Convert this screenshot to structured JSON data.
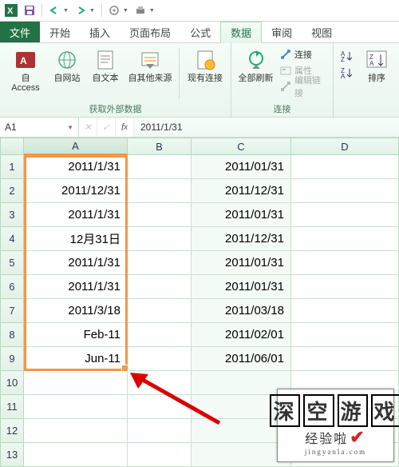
{
  "qat_icons": [
    "excel",
    "save",
    "undo",
    "redo",
    "touch",
    "print"
  ],
  "tabs": {
    "file": "文件",
    "items": [
      "开始",
      "插入",
      "页面布局",
      "公式",
      "数据",
      "审阅",
      "视图"
    ],
    "active_index": 4
  },
  "ribbon": {
    "group_ext": {
      "label": "获取外部数据",
      "btns": [
        "自 Access",
        "自网站",
        "自文本",
        "自其他来源",
        "现有连接"
      ]
    },
    "group_conn": {
      "label": "连接",
      "main": "全部刷新",
      "rows": [
        "连接",
        "属性",
        "编辑链接"
      ]
    },
    "group_sort": {
      "label": "",
      "btn": "排序"
    }
  },
  "namebox": "A1",
  "formula": "2011/1/31",
  "columns": [
    "A",
    "B",
    "C",
    "D"
  ],
  "rows": [
    {
      "n": "1",
      "A": "2011/1/31",
      "B": "",
      "C": "2011/01/31",
      "D": ""
    },
    {
      "n": "2",
      "A": "2011/12/31",
      "B": "",
      "C": "2011/12/31",
      "D": ""
    },
    {
      "n": "3",
      "A": "2011/1/31",
      "B": "",
      "C": "2011/01/31",
      "D": ""
    },
    {
      "n": "4",
      "A": "12月31日",
      "B": "",
      "C": "2011/12/31",
      "D": ""
    },
    {
      "n": "5",
      "A": "2011/1/31",
      "B": "",
      "C": "2011/01/31",
      "D": ""
    },
    {
      "n": "6",
      "A": "2011/1/31",
      "B": "",
      "C": "2011/01/31",
      "D": ""
    },
    {
      "n": "7",
      "A": "2011/3/18",
      "B": "",
      "C": "2011/03/18",
      "D": ""
    },
    {
      "n": "8",
      "A": "Feb-11",
      "B": "",
      "C": "2011/02/01",
      "D": ""
    },
    {
      "n": "9",
      "A": "Jun-11",
      "B": "",
      "C": "2011/06/01",
      "D": ""
    },
    {
      "n": "10",
      "A": "",
      "B": "",
      "C": "",
      "D": ""
    },
    {
      "n": "11",
      "A": "",
      "B": "",
      "C": "",
      "D": ""
    },
    {
      "n": "12",
      "A": "",
      "B": "",
      "C": "",
      "D": ""
    },
    {
      "n": "13",
      "A": "",
      "B": "",
      "C": "",
      "D": ""
    }
  ],
  "watermark": {
    "top": "深空游戏",
    "mid": "经验啦",
    "bot": "jingyanla.com"
  }
}
